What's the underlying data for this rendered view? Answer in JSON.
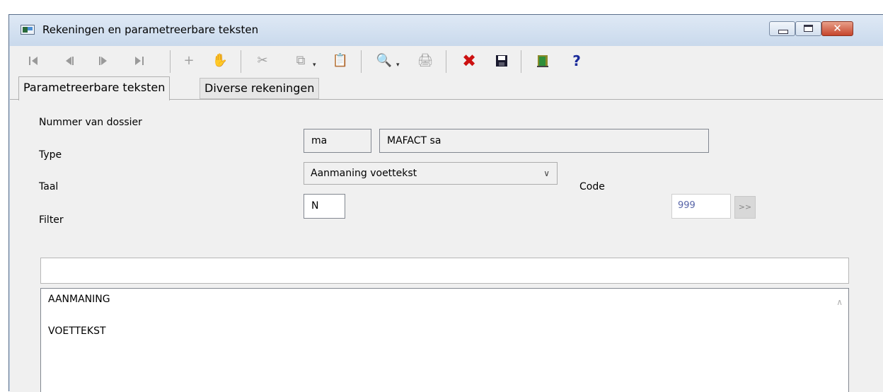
{
  "window": {
    "title": "Rekeningen en parametreerbare teksten",
    "buttons": {
      "minimize": "—",
      "maximize": "□",
      "close": "✕"
    }
  },
  "toolbar": {
    "first": "⏮",
    "prev": "◀",
    "next": "▶",
    "last": "⏭",
    "add": "+",
    "delete": "✋",
    "cut": "✂",
    "copy": "⧉",
    "paste": "📋",
    "search": "🔍",
    "print": "🖨",
    "cancel": "✖",
    "save": "💾",
    "exit": "🚪",
    "help": "?",
    "dropdown": "▾"
  },
  "tabs": [
    {
      "label": "Parametreerbare teksten",
      "active": true
    },
    {
      "label": "Diverse rekeningen",
      "active": false
    }
  ],
  "form": {
    "dossier_label": "Nummer van dossier",
    "dossier_code": "ma",
    "dossier_name": "MAFACT sa",
    "type_label": "Type",
    "type_value": "Aanmaning voettekst",
    "taal_label": "Taal",
    "taal_value": "N",
    "code_label": "Code",
    "code_value": "999",
    "code_button": ">>",
    "filter_label": "Filter",
    "filter_value": ""
  },
  "memo": {
    "lines": [
      "AANMANING",
      "VOETTEKST"
    ]
  },
  "colors": {
    "title_bar": "#cfdcec",
    "panel": "#f0f0f0",
    "close_button": "#c6452c",
    "cancel_icon": "#cc1111",
    "help_icon": "#1a2a9a"
  }
}
